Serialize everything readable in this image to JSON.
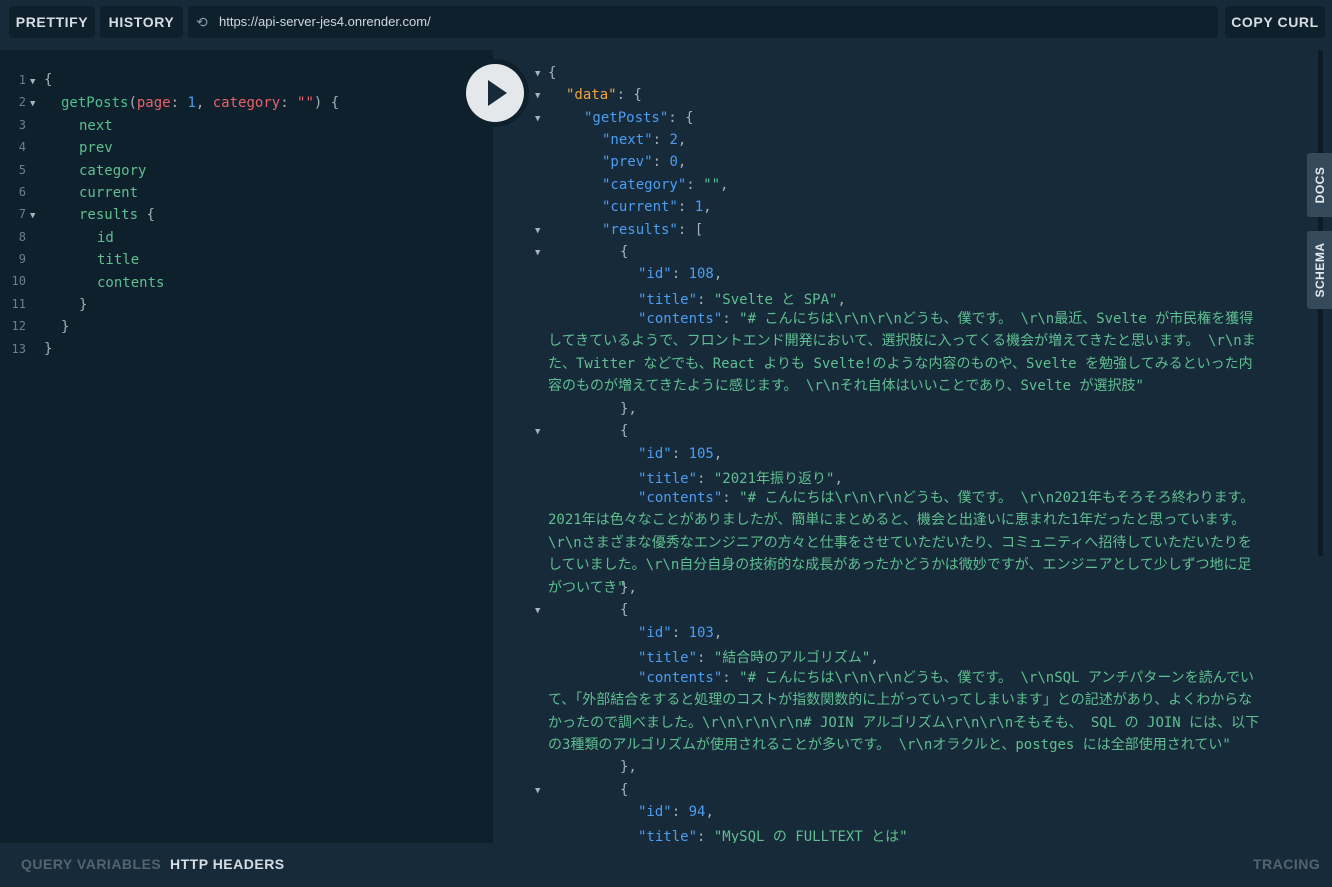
{
  "toolbar": {
    "prettify": "PRETTIFY",
    "history": "HISTORY",
    "url": "https://api-server-jes4.onrender.com/",
    "copy_curl": "COPY CURL"
  },
  "editor": {
    "line_numbers": [
      "1",
      "2",
      "3",
      "4",
      "5",
      "6",
      "7",
      "8",
      "9",
      "10",
      "11",
      "12",
      "13"
    ],
    "query_name": "getPosts",
    "arg_page_name": "page",
    "arg_page_value": "1",
    "arg_category_name": "category",
    "arg_category_value": "\"\"",
    "fields": [
      "next",
      "prev",
      "category",
      "current",
      "results"
    ],
    "result_fields": [
      "id",
      "title",
      "contents"
    ]
  },
  "result": {
    "data_key": "\"data\"",
    "getposts_key": "\"getPosts\"",
    "next_key": "\"next\"",
    "next_val": "2",
    "prev_key": "\"prev\"",
    "prev_val": "0",
    "category_key": "\"category\"",
    "category_val": "\"\"",
    "current_key": "\"current\"",
    "current_val": "1",
    "results_key": "\"results\"",
    "id_key": "\"id\"",
    "title_key": "\"title\"",
    "contents_key": "\"contents\"",
    "items": [
      {
        "id": "108",
        "title": "\"Svelte と SPA\"",
        "contents": "\"# こんにちは\\r\\n\\r\\nどうも、僕です。  \\r\\n最近、Svelte が市民権を獲得してきているようで、フロントエンド開発において、選択肢に入ってくる機会が増えてきたと思います。  \\r\\nまた、Twitter などでも、React よりも Svelte!のような内容のものや、Svelte を勉強してみるといった内容のものが増えてきたように感じます。  \\r\\nそれ自体はいいことであり、Svelte が選択肢\""
      },
      {
        "id": "105",
        "title": "\"2021年振り返り\"",
        "contents": "\"# こんにちは\\r\\n\\r\\nどうも、僕です。  \\r\\n2021年もそろそろ終わります。2021年は色々なことがありましたが、簡単にまとめると、機会と出逢いに恵まれた1年だったと思っています。  \\r\\nさまざまな優秀なエンジニアの方々と仕事をさせていただいたり、コミュニティへ招待していただいたりをしていました。\\r\\n自分自身の技術的な成長があったかどうかは微妙ですが、エンジニアとして少しずつ地に足がついてき\""
      },
      {
        "id": "103",
        "title": "\"結合時のアルゴリズム\"",
        "contents": "\"# こんにちは\\r\\n\\r\\nどうも、僕です。  \\r\\nSQL アンチパターンを読んでいて、「外部結合をすると処理のコストが指数関数的に上がっていってしまいます」との記述があり、よくわからなかったので調べました。\\r\\n\\r\\n\\r\\n# JOIN アルゴリズム\\r\\n\\r\\nそもそも、 SQL の JOIN には、以下の3種類のアルゴリズムが使用されることが多いです。  \\r\\nオラクルと、postges には全部使用されてい\""
      },
      {
        "id": "94",
        "title": "\"MySQL の FULLTEXT とは\""
      }
    ]
  },
  "side_tabs": {
    "docs": "DOCS",
    "schema": "SCHEMA"
  },
  "bottom": {
    "query_variables": "QUERY VARIABLES",
    "http_headers": "HTTP HEADERS",
    "tracing": "TRACING"
  }
}
